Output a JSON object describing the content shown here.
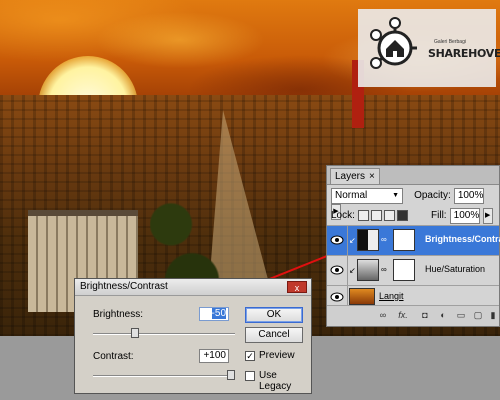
{
  "logo": {
    "tagline": "Galeri Berbagi",
    "name": "SHAREHOVEL"
  },
  "layers_panel": {
    "tab_label": "Layers",
    "tab_close": "×",
    "blend_mode": "Normal",
    "opacity_label": "Opacity:",
    "opacity_value": "100%",
    "lock_label": "Lock:",
    "fill_label": "Fill:",
    "fill_value": "100%",
    "layers": [
      {
        "name": "Brightness/Contrast",
        "selected": true
      },
      {
        "name": "Hue/Saturation",
        "selected": false
      },
      {
        "name": "Langit",
        "selected": false
      }
    ],
    "footer_fx": "fx."
  },
  "brightness_contrast": {
    "title": "Brightness/Contrast",
    "close": "x",
    "brightness_label": "Brightness:",
    "brightness_value": "-50",
    "contrast_label": "Contrast:",
    "contrast_value": "+100",
    "ok_label": "OK",
    "cancel_label": "Cancel",
    "preview_label": "Preview",
    "preview_checked": true,
    "legacy_label": "Use Legacy",
    "legacy_checked": false
  },
  "colors": {
    "selected_layer": "#3a78d8",
    "arrow": "#e01010",
    "close_button": "#c0392b"
  }
}
